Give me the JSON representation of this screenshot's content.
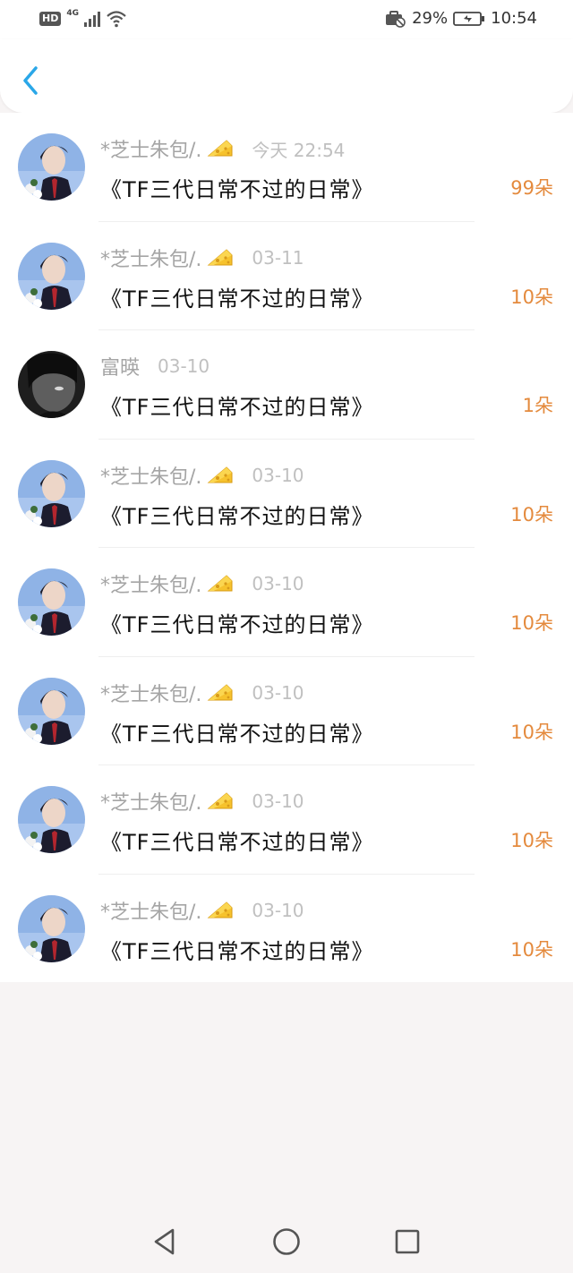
{
  "status_bar": {
    "hd": "HD",
    "network": "4G",
    "battery_percent": "29%",
    "time": "10:54"
  },
  "header": {
    "back_icon": "chevron-left-icon"
  },
  "colors": {
    "accent": "#2aa7e8",
    "count": "#e48a3d",
    "name": "#a5a5a5",
    "time": "#c0c0c0"
  },
  "list": {
    "items": [
      {
        "sender": "*芝士朱包/.",
        "time": "今天 22:54",
        "title": "《TF三代日常不过的日常》",
        "count": "99朵",
        "avatar": "boy",
        "has_cheese": true
      },
      {
        "sender": "*芝士朱包/.",
        "time": "03-11",
        "title": "《TF三代日常不过的日常》",
        "count": "10朵",
        "avatar": "boy",
        "has_cheese": true
      },
      {
        "sender": "富暎",
        "time": "03-10",
        "title": "《TF三代日常不过的日常》",
        "count": "1朵",
        "avatar": "dark",
        "has_cheese": false
      },
      {
        "sender": "*芝士朱包/.",
        "time": "03-10",
        "title": "《TF三代日常不过的日常》",
        "count": "10朵",
        "avatar": "boy",
        "has_cheese": true
      },
      {
        "sender": "*芝士朱包/.",
        "time": "03-10",
        "title": "《TF三代日常不过的日常》",
        "count": "10朵",
        "avatar": "boy",
        "has_cheese": true
      },
      {
        "sender": "*芝士朱包/.",
        "time": "03-10",
        "title": "《TF三代日常不过的日常》",
        "count": "10朵",
        "avatar": "boy",
        "has_cheese": true
      },
      {
        "sender": "*芝士朱包/.",
        "time": "03-10",
        "title": "《TF三代日常不过的日常》",
        "count": "10朵",
        "avatar": "boy",
        "has_cheese": true
      },
      {
        "sender": "*芝士朱包/.",
        "time": "03-10",
        "title": "《TF三代日常不过的日常》",
        "count": "10朵",
        "avatar": "boy",
        "has_cheese": true
      }
    ]
  },
  "nav_bar": {
    "back_icon": "triangle-back-icon",
    "home_icon": "circle-home-icon",
    "recent_icon": "square-recents-icon"
  }
}
